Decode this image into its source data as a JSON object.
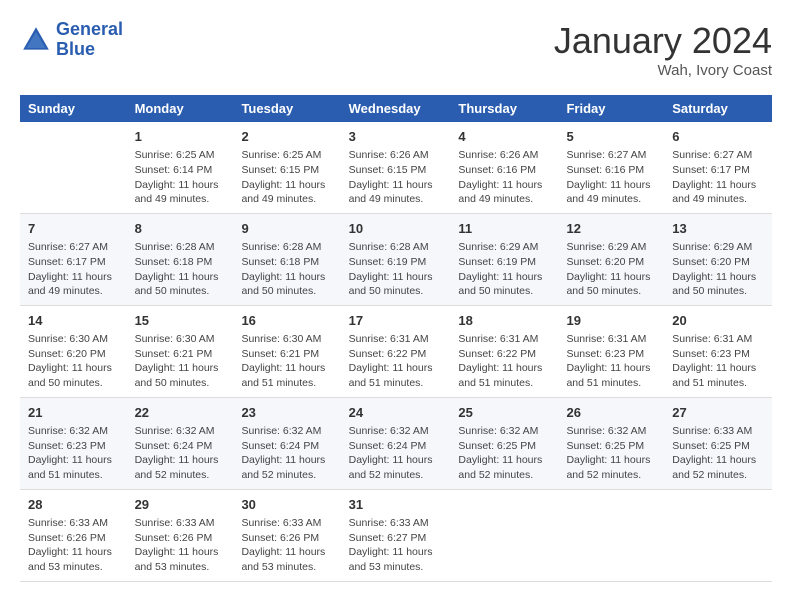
{
  "logo": {
    "line1": "General",
    "line2": "Blue"
  },
  "title": "January 2024",
  "location": "Wah, Ivory Coast",
  "days_of_week": [
    "Sunday",
    "Monday",
    "Tuesday",
    "Wednesday",
    "Thursday",
    "Friday",
    "Saturday"
  ],
  "weeks": [
    [
      {
        "day": "",
        "info": ""
      },
      {
        "day": "1",
        "info": "Sunrise: 6:25 AM\nSunset: 6:14 PM\nDaylight: 11 hours and 49 minutes."
      },
      {
        "day": "2",
        "info": "Sunrise: 6:25 AM\nSunset: 6:15 PM\nDaylight: 11 hours and 49 minutes."
      },
      {
        "day": "3",
        "info": "Sunrise: 6:26 AM\nSunset: 6:15 PM\nDaylight: 11 hours and 49 minutes."
      },
      {
        "day": "4",
        "info": "Sunrise: 6:26 AM\nSunset: 6:16 PM\nDaylight: 11 hours and 49 minutes."
      },
      {
        "day": "5",
        "info": "Sunrise: 6:27 AM\nSunset: 6:16 PM\nDaylight: 11 hours and 49 minutes."
      },
      {
        "day": "6",
        "info": "Sunrise: 6:27 AM\nSunset: 6:17 PM\nDaylight: 11 hours and 49 minutes."
      }
    ],
    [
      {
        "day": "7",
        "info": "Sunrise: 6:27 AM\nSunset: 6:17 PM\nDaylight: 11 hours and 49 minutes."
      },
      {
        "day": "8",
        "info": "Sunrise: 6:28 AM\nSunset: 6:18 PM\nDaylight: 11 hours and 50 minutes."
      },
      {
        "day": "9",
        "info": "Sunrise: 6:28 AM\nSunset: 6:18 PM\nDaylight: 11 hours and 50 minutes."
      },
      {
        "day": "10",
        "info": "Sunrise: 6:28 AM\nSunset: 6:19 PM\nDaylight: 11 hours and 50 minutes."
      },
      {
        "day": "11",
        "info": "Sunrise: 6:29 AM\nSunset: 6:19 PM\nDaylight: 11 hours and 50 minutes."
      },
      {
        "day": "12",
        "info": "Sunrise: 6:29 AM\nSunset: 6:20 PM\nDaylight: 11 hours and 50 minutes."
      },
      {
        "day": "13",
        "info": "Sunrise: 6:29 AM\nSunset: 6:20 PM\nDaylight: 11 hours and 50 minutes."
      }
    ],
    [
      {
        "day": "14",
        "info": "Sunrise: 6:30 AM\nSunset: 6:20 PM\nDaylight: 11 hours and 50 minutes."
      },
      {
        "day": "15",
        "info": "Sunrise: 6:30 AM\nSunset: 6:21 PM\nDaylight: 11 hours and 50 minutes."
      },
      {
        "day": "16",
        "info": "Sunrise: 6:30 AM\nSunset: 6:21 PM\nDaylight: 11 hours and 51 minutes."
      },
      {
        "day": "17",
        "info": "Sunrise: 6:31 AM\nSunset: 6:22 PM\nDaylight: 11 hours and 51 minutes."
      },
      {
        "day": "18",
        "info": "Sunrise: 6:31 AM\nSunset: 6:22 PM\nDaylight: 11 hours and 51 minutes."
      },
      {
        "day": "19",
        "info": "Sunrise: 6:31 AM\nSunset: 6:23 PM\nDaylight: 11 hours and 51 minutes."
      },
      {
        "day": "20",
        "info": "Sunrise: 6:31 AM\nSunset: 6:23 PM\nDaylight: 11 hours and 51 minutes."
      }
    ],
    [
      {
        "day": "21",
        "info": "Sunrise: 6:32 AM\nSunset: 6:23 PM\nDaylight: 11 hours and 51 minutes."
      },
      {
        "day": "22",
        "info": "Sunrise: 6:32 AM\nSunset: 6:24 PM\nDaylight: 11 hours and 52 minutes."
      },
      {
        "day": "23",
        "info": "Sunrise: 6:32 AM\nSunset: 6:24 PM\nDaylight: 11 hours and 52 minutes."
      },
      {
        "day": "24",
        "info": "Sunrise: 6:32 AM\nSunset: 6:24 PM\nDaylight: 11 hours and 52 minutes."
      },
      {
        "day": "25",
        "info": "Sunrise: 6:32 AM\nSunset: 6:25 PM\nDaylight: 11 hours and 52 minutes."
      },
      {
        "day": "26",
        "info": "Sunrise: 6:32 AM\nSunset: 6:25 PM\nDaylight: 11 hours and 52 minutes."
      },
      {
        "day": "27",
        "info": "Sunrise: 6:33 AM\nSunset: 6:25 PM\nDaylight: 11 hours and 52 minutes."
      }
    ],
    [
      {
        "day": "28",
        "info": "Sunrise: 6:33 AM\nSunset: 6:26 PM\nDaylight: 11 hours and 53 minutes."
      },
      {
        "day": "29",
        "info": "Sunrise: 6:33 AM\nSunset: 6:26 PM\nDaylight: 11 hours and 53 minutes."
      },
      {
        "day": "30",
        "info": "Sunrise: 6:33 AM\nSunset: 6:26 PM\nDaylight: 11 hours and 53 minutes."
      },
      {
        "day": "31",
        "info": "Sunrise: 6:33 AM\nSunset: 6:27 PM\nDaylight: 11 hours and 53 minutes."
      },
      {
        "day": "",
        "info": ""
      },
      {
        "day": "",
        "info": ""
      },
      {
        "day": "",
        "info": ""
      }
    ]
  ]
}
